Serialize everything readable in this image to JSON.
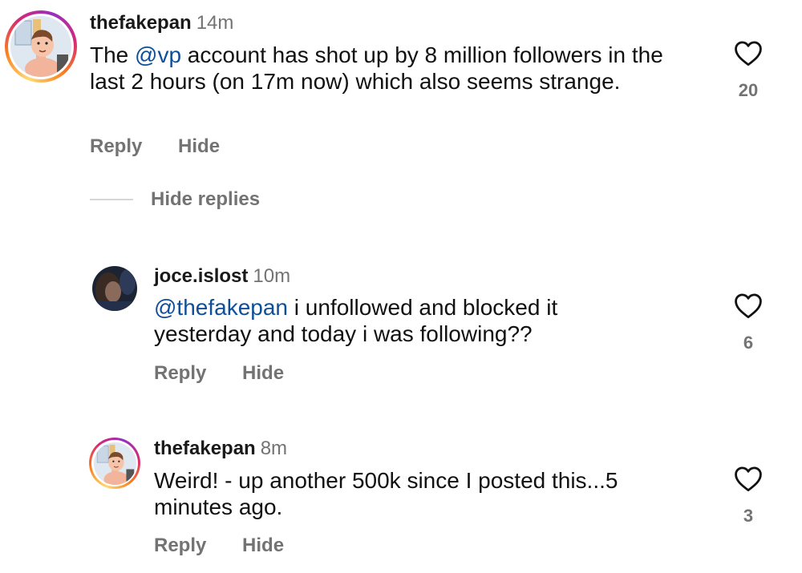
{
  "comments": [
    {
      "username": "thefakepan",
      "time": "14m",
      "text": {
        "before": "The ",
        "mention": "@vp",
        "after": " account has shot up by 8 million followers in the last 2 hours (on 17m now) which also seems strange."
      },
      "reply_label": "Reply",
      "hide_label": "Hide",
      "likes": "20"
    },
    {
      "username": "joce.islost",
      "time": "10m",
      "text": {
        "before": "",
        "mention": "@thefakepan",
        "after": " i unfollowed and blocked it yesterday and today i was following??"
      },
      "reply_label": "Reply",
      "hide_label": "Hide",
      "likes": "6"
    },
    {
      "username": "thefakepan",
      "time": "8m",
      "text": {
        "before": "Weird! - up another 500k since I posted this...5 minutes ago.",
        "mention": "",
        "after": ""
      },
      "reply_label": "Reply",
      "hide_label": "Hide",
      "likes": "3"
    }
  ],
  "hide_replies_label": "Hide replies",
  "icons": {
    "like": "heart-outline-icon"
  },
  "colors": {
    "mention": "#0f4f9a",
    "muted": "#737373",
    "ring_start": "#feda75",
    "ring_end": "#962fbf"
  }
}
